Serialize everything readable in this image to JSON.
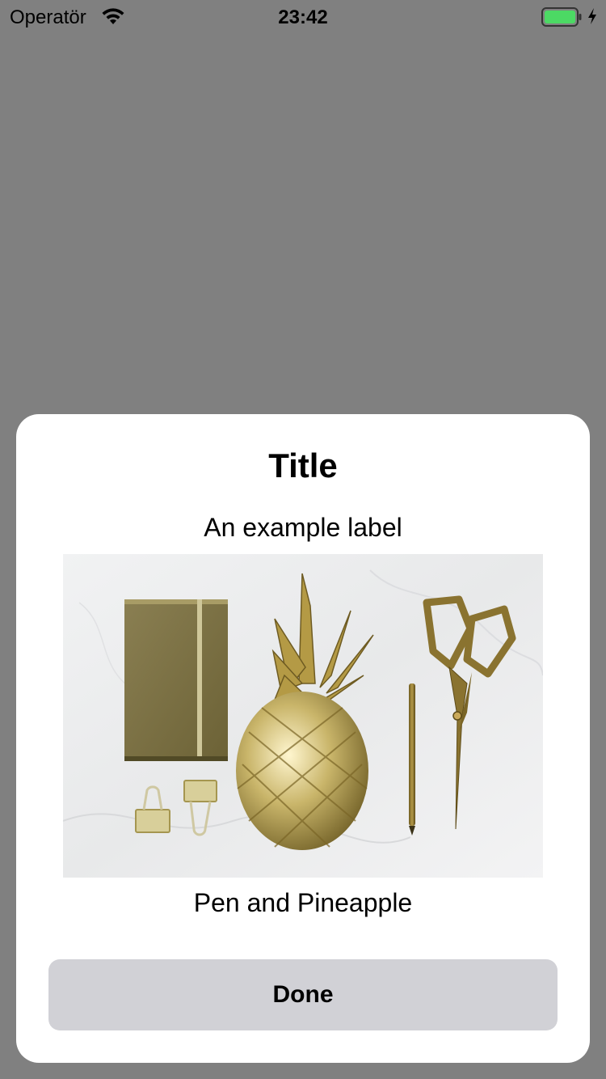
{
  "status_bar": {
    "carrier": "Operatör",
    "time": "23:42",
    "wifi_icon": "wifi-icon",
    "battery_icon": "battery-icon",
    "charging_icon": "charging-bolt-icon",
    "battery_color": "#4cd964"
  },
  "dialog": {
    "title": "Title",
    "subtitle": "An example label",
    "image_icon": "photo-image",
    "caption": "Pen and Pineapple",
    "done_label": "Done",
    "background_color": "#ffffff",
    "button_color": "#d1d1d6"
  },
  "backdrop_color": "#808080"
}
